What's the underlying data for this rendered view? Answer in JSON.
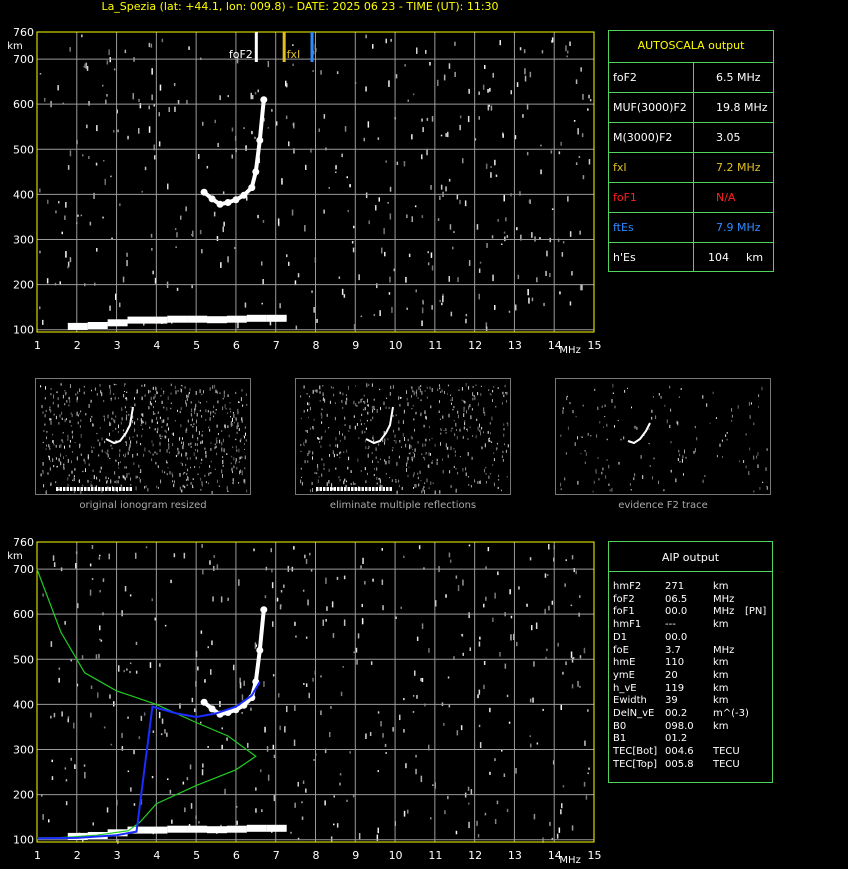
{
  "title": "La_Spezia (lat: +44.1, lon: 009.8) - DATE: 2025 06 23 - TIME (UT): 11:30",
  "colors": {
    "grid": "#9a9a9a",
    "axis": "#ffff00",
    "panel_border": "#4fd65a",
    "red": "#ff2020",
    "blue": "#2e8bff",
    "olive": "#e0c020",
    "green": "#22cc22",
    "trace": "#1a2cff"
  },
  "autoscala": {
    "title": "AUTOSCALA output",
    "rows": [
      {
        "key": "foF2",
        "value": "6.5 MHz",
        "color": "#ffffff"
      },
      {
        "key": "MUF(3000)F2",
        "value": "19.8 MHz",
        "color": "#ffffff"
      },
      {
        "key": "M(3000)F2",
        "value": "3.05",
        "color": "#ffffff"
      },
      {
        "key": "fxI",
        "value": "7.2 MHz",
        "color": "#e0c020"
      },
      {
        "key": "foF1",
        "value": "N/A",
        "color": "#ff2020"
      },
      {
        "key": "ftEs",
        "value": "7.9 MHz",
        "color": "#2e8bff"
      },
      {
        "key": "h'Es",
        "value": "104",
        "unit": "km",
        "color": "#ffffff"
      }
    ]
  },
  "aip": {
    "title": "AIP output",
    "rows": [
      {
        "k": "hmF2",
        "v": "271",
        "u": "km"
      },
      {
        "k": "foF2",
        "v": "06.5",
        "u": "MHz"
      },
      {
        "k": "foF1",
        "v": "00.0",
        "u": "MHz",
        "x": "[PN]"
      },
      {
        "k": "hmF1",
        "v": "---",
        "u": "km"
      },
      {
        "k": "D1",
        "v": "00.0",
        "u": ""
      },
      {
        "k": "foE",
        "v": "3.7",
        "u": "MHz"
      },
      {
        "k": "hmE",
        "v": "110",
        "u": "km"
      },
      {
        "k": "ymE",
        "v": "20",
        "u": "km"
      },
      {
        "k": "h_vE",
        "v": "119",
        "u": "km"
      },
      {
        "k": "Ewidth",
        "v": "39",
        "u": "km"
      },
      {
        "k": "DelN_vE",
        "v": "00.2",
        "u": "m^(-3)"
      },
      {
        "k": "B0",
        "v": "098.0",
        "u": "km"
      },
      {
        "k": "B1",
        "v": "01.2",
        "u": ""
      },
      {
        "k": "TEC[Bot]",
        "v": "004.6",
        "u": "TECU"
      },
      {
        "k": "TEC[Top]",
        "v": "005.8",
        "u": "TECU"
      }
    ]
  },
  "thumbnails": [
    {
      "caption": "original ionogram resized"
    },
    {
      "caption": "eliminate multiple reflections"
    },
    {
      "caption": "evidence F2 trace"
    }
  ],
  "chart_data": [
    {
      "type": "scatter",
      "title": "",
      "xlabel": "MHz",
      "ylabel": "km",
      "xlim": [
        1,
        15
      ],
      "ylim": [
        95,
        760
      ],
      "xticks": [
        1,
        2,
        3,
        4,
        5,
        6,
        7,
        8,
        9,
        10,
        11,
        12,
        13,
        14,
        15
      ],
      "yticks": [
        100,
        200,
        300,
        400,
        500,
        600,
        700,
        760
      ],
      "markers": [
        {
          "label": "foF2",
          "x": 6.5,
          "color": "#ffffff"
        },
        {
          "label": "fxI",
          "x": 7.2,
          "color": "#e0c020"
        },
        {
          "label": "",
          "x": 7.9,
          "color": "#2e8bff"
        }
      ],
      "series": [
        {
          "name": "Es trace",
          "x": [
            2.0,
            2.5,
            3.0,
            3.5,
            4.0,
            4.5,
            5.0,
            5.5,
            6.0,
            6.5,
            7.0
          ],
          "y": [
            104,
            106,
            112,
            118,
            118,
            120,
            120,
            119,
            120,
            122,
            122
          ]
        },
        {
          "name": "F2 trace",
          "x": [
            5.2,
            5.4,
            5.6,
            5.8,
            6.0,
            6.2,
            6.4,
            6.5,
            6.6,
            6.7
          ],
          "y": [
            405,
            390,
            378,
            382,
            388,
            398,
            415,
            450,
            520,
            610
          ]
        }
      ]
    },
    {
      "type": "line",
      "title": "",
      "xlabel": "MHz",
      "ylabel": "km",
      "xlim": [
        1,
        15
      ],
      "ylim": [
        95,
        760
      ],
      "xticks": [
        1,
        2,
        3,
        4,
        5,
        6,
        7,
        8,
        9,
        10,
        11,
        12,
        13,
        14,
        15
      ],
      "yticks": [
        100,
        200,
        300,
        400,
        500,
        600,
        700,
        760
      ],
      "series": [
        {
          "x": [
            1.0,
            1.6,
            2.2,
            3.0,
            4.0,
            5.0,
            5.8,
            6.5,
            6.0,
            5.0,
            4.0,
            3.6,
            3.3,
            2.5,
            1.5,
            1.0
          ],
          "y": [
            700,
            560,
            470,
            430,
            400,
            360,
            330,
            285,
            255,
            220,
            180,
            140,
            120,
            110,
            104,
            104
          ]
        },
        {
          "x": [
            1.0,
            2.0,
            3.0,
            3.5,
            3.9,
            4.5,
            5.0,
            5.5,
            6.0,
            6.4,
            6.6
          ],
          "y": [
            103,
            104,
            110,
            118,
            395,
            380,
            372,
            380,
            395,
            420,
            450
          ]
        }
      ],
      "overlay_traces": [
        {
          "name": "Es trace",
          "x": [
            2.0,
            2.5,
            3.0,
            3.5,
            4.0,
            4.5,
            5.0,
            5.5,
            6.0,
            6.5,
            7.0
          ],
          "y": [
            104,
            106,
            112,
            118,
            118,
            120,
            120,
            119,
            120,
            122,
            122
          ]
        },
        {
          "name": "F2 trace",
          "x": [
            5.2,
            5.4,
            5.6,
            5.8,
            6.0,
            6.2,
            6.4,
            6.5,
            6.6,
            6.7
          ],
          "y": [
            405,
            390,
            378,
            382,
            388,
            398,
            415,
            450,
            520,
            610
          ]
        }
      ]
    }
  ]
}
